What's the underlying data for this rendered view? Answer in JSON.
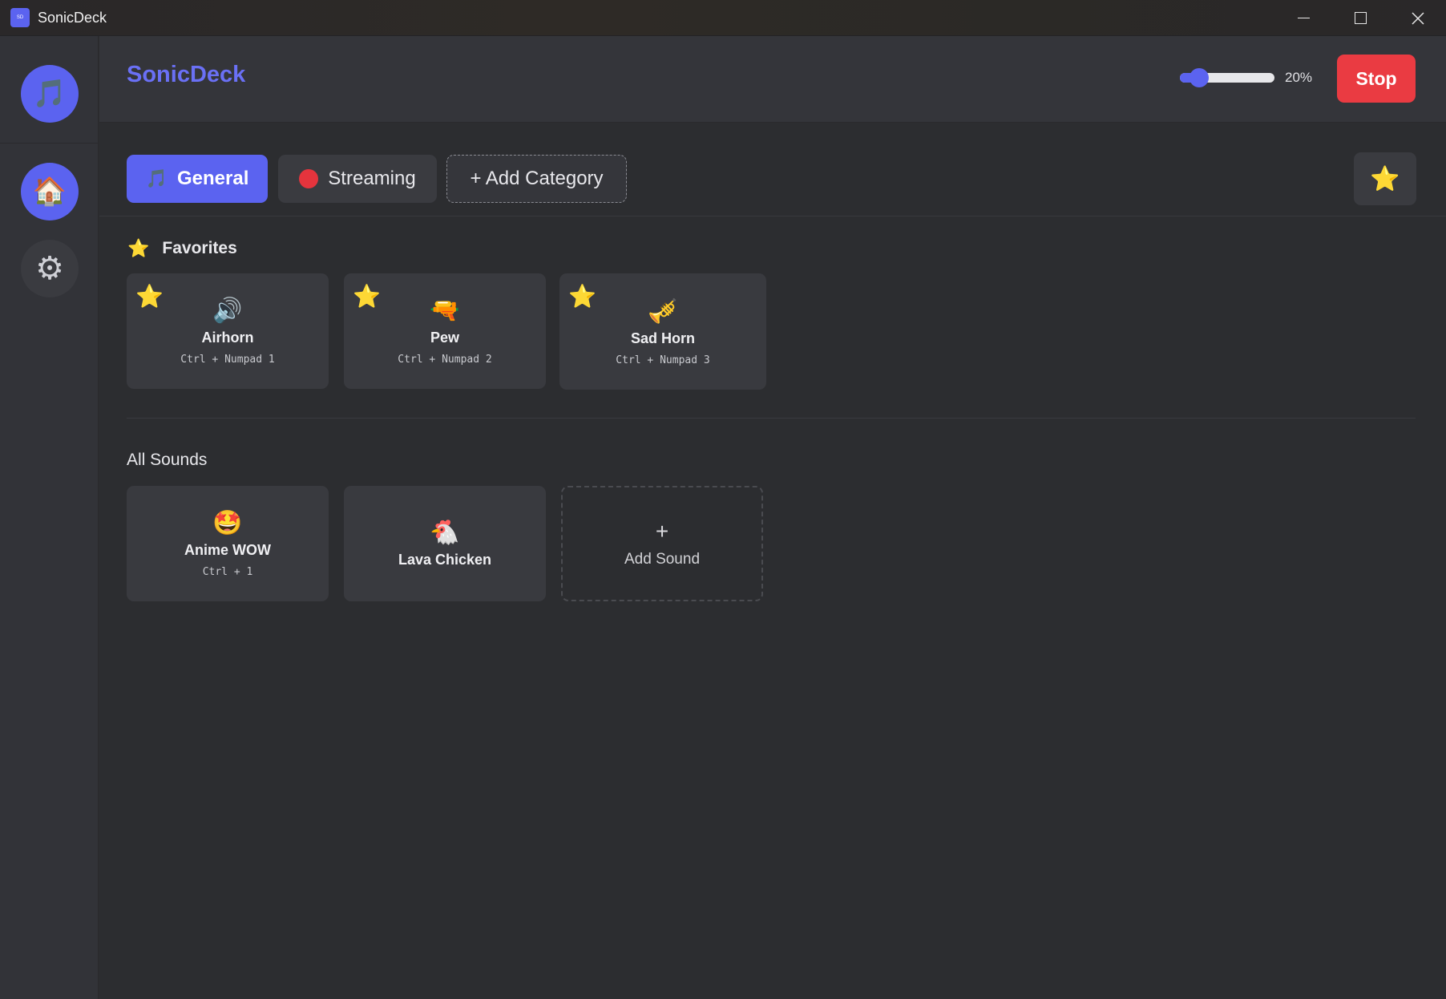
{
  "window": {
    "title": "SonicDeck",
    "icon_text": "SD",
    "controls": [
      "minimize",
      "maximize",
      "close"
    ]
  },
  "sidebar": {
    "logo_icon": "music-note-icon",
    "items": [
      {
        "name": "home",
        "icon": "house-icon",
        "active": true
      },
      {
        "name": "settings",
        "icon": "gear-icon",
        "active": false
      }
    ]
  },
  "header": {
    "brand": "SonicDeck",
    "volume": {
      "value": 20,
      "label": "20%"
    },
    "stop_label": "Stop"
  },
  "categories": {
    "tabs": [
      {
        "label": "General",
        "icon": "music-note-icon",
        "active": true
      },
      {
        "label": "Streaming",
        "icon": "red-circle-icon",
        "active": false
      }
    ],
    "add_label": "+ Add Category",
    "favorites_toggle_icon": "star-icon"
  },
  "favorites": {
    "title": "Favorites",
    "items": [
      {
        "name": "Airhorn",
        "hotkey": "Ctrl + Numpad 1",
        "emoji": "🔊",
        "icon": "speaker-icon"
      },
      {
        "name": "Pew",
        "hotkey": "Ctrl + Numpad 2",
        "emoji": "🔫",
        "icon": "water-pistol-icon"
      },
      {
        "name": "Sad Horn",
        "hotkey": "Ctrl + Numpad 3",
        "emoji": "🎺",
        "icon": "trumpet-icon"
      }
    ]
  },
  "all_sounds": {
    "title": "All Sounds",
    "items": [
      {
        "name": "Anime WOW",
        "hotkey": "Ctrl + 1",
        "emoji": "🤩",
        "icon": "star-struck-icon"
      },
      {
        "name": "Lava Chicken",
        "hotkey": "",
        "emoji": "🐔",
        "icon": "chicken-icon"
      }
    ],
    "add_plus": "+",
    "add_label": "Add Sound"
  },
  "colors": {
    "accent": "#5b63f0",
    "stop": "#ea3b42",
    "background": "#2c2d30",
    "card": "#393a3f",
    "star": "#f6c52b"
  }
}
